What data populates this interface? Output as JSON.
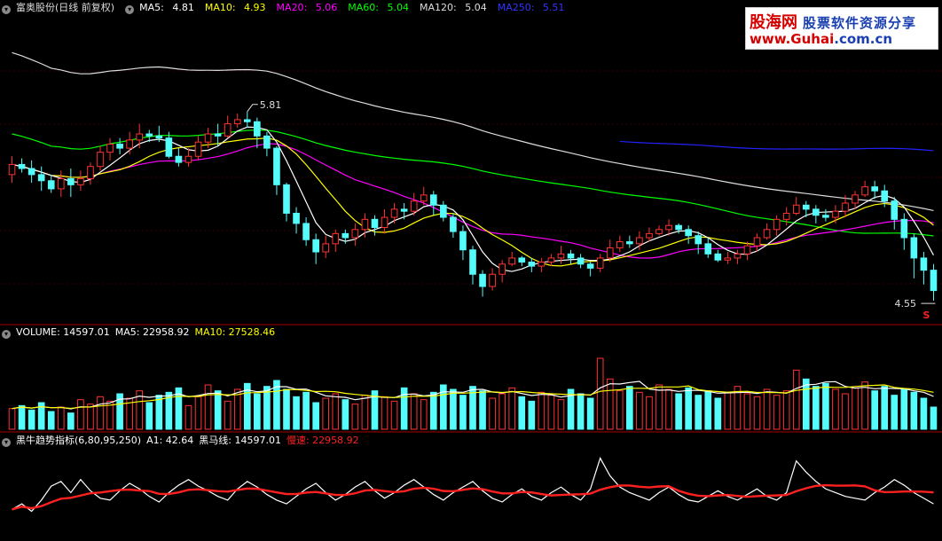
{
  "colors": {
    "ma5": "#ffffff",
    "ma10": "#ffff00",
    "ma20": "#ff00ff",
    "ma60": "#00ff00",
    "ma120": "#dddddd",
    "ma250": "#2222ff",
    "up": "#ff3232",
    "down": "#54fcfc",
    "slow": "#ff2020",
    "divider": "#aa0000"
  },
  "price_panel": {
    "title": "富奥股份(日线 前复权)",
    "ma5": {
      "label": "MA5:",
      "value": "4.81"
    },
    "ma10": {
      "label": "MA10:",
      "value": "4.93"
    },
    "ma20": {
      "label": "MA20:",
      "value": "5.06"
    },
    "ma60": {
      "label": "MA60:",
      "value": "5.04"
    },
    "ma120": {
      "label": "MA120:",
      "value": "5.04"
    },
    "ma250": {
      "label": "MA250:",
      "value": "5.51"
    },
    "high_marker": "5.81",
    "low_marker": "4.55",
    "signal_marker": "S"
  },
  "volume_panel": {
    "title": "VOLUME: 14597.01",
    "ma5": "MA5: 22958.92",
    "ma10": "MA10: 27528.46"
  },
  "indicator_panel": {
    "title": "黑牛趋势指标(6,80,95,250)",
    "a1": "A1: 42.64",
    "black_horse": "黑马线: 14597.01",
    "slow": "慢速: 22958.92"
  },
  "watermark": {
    "line1a": "股海网",
    "line1b": "股票软件资源分享",
    "line2a": "www.Guhai",
    "line2b": ".com.cn"
  },
  "chart_data": {
    "type": "candlestick",
    "candles": [
      [
        5.17,
        5.22,
        5.13,
        5.26
      ],
      [
        5.22,
        5.2,
        5.18,
        5.25
      ],
      [
        5.2,
        5.17,
        5.13,
        5.24
      ],
      [
        5.17,
        5.14,
        5.09,
        5.21
      ],
      [
        5.14,
        5.1,
        5.08,
        5.17
      ],
      [
        5.1,
        5.15,
        5.06,
        5.19
      ],
      [
        5.15,
        5.12,
        5.06,
        5.2
      ],
      [
        5.12,
        5.15,
        5.09,
        5.19
      ],
      [
        5.15,
        5.21,
        5.12,
        5.23
      ],
      [
        5.21,
        5.28,
        5.19,
        5.31
      ],
      [
        5.28,
        5.32,
        5.24,
        5.35
      ],
      [
        5.32,
        5.3,
        5.27,
        5.35
      ],
      [
        5.3,
        5.34,
        5.27,
        5.38
      ],
      [
        5.34,
        5.37,
        5.3,
        5.42
      ],
      [
        5.37,
        5.36,
        5.33,
        5.39
      ],
      [
        5.36,
        5.35,
        5.33,
        5.41
      ],
      [
        5.35,
        5.26,
        5.25,
        5.38
      ],
      [
        5.26,
        5.23,
        5.21,
        5.3
      ],
      [
        5.23,
        5.26,
        5.21,
        5.3
      ],
      [
        5.26,
        5.33,
        5.24,
        5.36
      ],
      [
        5.33,
        5.37,
        5.3,
        5.4
      ],
      [
        5.37,
        5.36,
        5.31,
        5.42
      ],
      [
        5.36,
        5.42,
        5.35,
        5.46
      ],
      [
        5.42,
        5.44,
        5.4,
        5.47
      ],
      [
        5.44,
        5.43,
        5.4,
        5.48
      ],
      [
        5.43,
        5.36,
        5.3,
        5.45
      ],
      [
        5.36,
        5.3,
        5.26,
        5.38
      ],
      [
        5.3,
        5.12,
        5.07,
        5.31
      ],
      [
        5.12,
        4.98,
        4.94,
        5.13
      ],
      [
        4.98,
        4.93,
        4.88,
        5.01
      ],
      [
        4.93,
        4.85,
        4.82,
        4.96
      ],
      [
        4.85,
        4.79,
        4.73,
        4.88
      ],
      [
        4.79,
        4.83,
        4.76,
        4.87
      ],
      [
        4.83,
        4.88,
        4.79,
        4.9
      ],
      [
        4.88,
        4.86,
        4.83,
        4.9
      ],
      [
        4.86,
        4.9,
        4.82,
        4.93
      ],
      [
        4.9,
        4.95,
        4.86,
        4.98
      ],
      [
        4.95,
        4.91,
        4.87,
        4.97
      ],
      [
        4.91,
        4.96,
        4.88,
        5
      ],
      [
        4.96,
        5,
        4.93,
        5.03
      ],
      [
        5,
        4.99,
        4.95,
        5.03
      ],
      [
        4.99,
        5.04,
        4.97,
        5.08
      ],
      [
        5.04,
        5.07,
        5.02,
        5.11
      ],
      [
        5.07,
        5.02,
        4.97,
        5.09
      ],
      [
        5.02,
        4.96,
        4.94,
        5.04
      ],
      [
        4.96,
        4.89,
        4.86,
        4.98
      ],
      [
        4.89,
        4.8,
        4.75,
        4.92
      ],
      [
        4.8,
        4.68,
        4.63,
        4.82
      ],
      [
        4.68,
        4.62,
        4.57,
        4.7
      ],
      [
        4.62,
        4.68,
        4.6,
        4.71
      ],
      [
        4.68,
        4.73,
        4.64,
        4.75
      ],
      [
        4.73,
        4.76,
        4.72,
        4.79
      ],
      [
        4.76,
        4.74,
        4.72,
        4.77
      ],
      [
        4.74,
        4.72,
        4.69,
        4.76
      ],
      [
        4.72,
        4.74,
        4.69,
        4.76
      ],
      [
        4.74,
        4.76,
        4.72,
        4.78
      ],
      [
        4.76,
        4.78,
        4.73,
        4.82
      ],
      [
        4.78,
        4.76,
        4.73,
        4.8
      ],
      [
        4.76,
        4.73,
        4.71,
        4.78
      ],
      [
        4.73,
        4.71,
        4.67,
        4.74
      ],
      [
        4.71,
        4.76,
        4.69,
        4.78
      ],
      [
        4.76,
        4.81,
        4.74,
        4.85
      ],
      [
        4.81,
        4.84,
        4.79,
        4.87
      ],
      [
        4.84,
        4.83,
        4.81,
        4.87
      ],
      [
        4.83,
        4.86,
        4.8,
        4.89
      ],
      [
        4.86,
        4.88,
        4.84,
        4.91
      ],
      [
        4.88,
        4.9,
        4.87,
        4.92
      ],
      [
        4.9,
        4.92,
        4.87,
        4.95
      ],
      [
        4.92,
        4.9,
        4.88,
        4.93
      ],
      [
        4.9,
        4.87,
        4.83,
        4.92
      ],
      [
        4.87,
        4.83,
        4.78,
        4.89
      ],
      [
        4.83,
        4.78,
        4.76,
        4.86
      ],
      [
        4.78,
        4.75,
        4.74,
        4.8
      ],
      [
        4.75,
        4.76,
        4.73,
        4.79
      ],
      [
        4.76,
        4.78,
        4.73,
        4.8
      ],
      [
        4.78,
        4.82,
        4.75,
        4.84
      ],
      [
        4.82,
        4.86,
        4.79,
        4.88
      ],
      [
        4.86,
        4.9,
        4.85,
        4.93
      ],
      [
        4.9,
        4.95,
        4.87,
        4.97
      ],
      [
        4.95,
        4.98,
        4.92,
        5.01
      ],
      [
        4.98,
        5.02,
        4.97,
        5.06
      ],
      [
        5.02,
        5,
        4.96,
        5.04
      ],
      [
        5,
        4.97,
        4.93,
        5.02
      ],
      [
        4.97,
        4.96,
        4.94,
        5
      ],
      [
        4.96,
        4.99,
        4.93,
        5.02
      ],
      [
        4.99,
        5.03,
        4.96,
        5.07
      ],
      [
        5.03,
        5.07,
        5,
        5.09
      ],
      [
        5.07,
        5.11,
        5.06,
        5.14
      ],
      [
        5.11,
        5.09,
        5.05,
        5.14
      ],
      [
        5.09,
        5.04,
        5.01,
        5.12
      ],
      [
        5.04,
        4.95,
        4.9,
        5.06
      ],
      [
        4.95,
        4.86,
        4.8,
        4.98
      ],
      [
        4.86,
        4.76,
        4.66,
        4.88
      ],
      [
        4.76,
        4.7,
        4.63,
        4.79
      ],
      [
        4.7,
        4.6,
        4.55,
        4.73
      ]
    ],
    "volume": [
      14,
      16,
      13,
      18,
      12,
      15,
      11,
      20,
      17,
      22,
      19,
      24,
      21,
      26,
      18,
      23,
      25,
      28,
      16,
      22,
      30,
      26,
      19,
      27,
      31,
      24,
      29,
      33,
      27,
      22,
      25,
      18,
      21,
      24,
      20,
      17,
      23,
      26,
      22,
      19,
      28,
      24,
      20,
      25,
      30,
      27,
      23,
      29,
      26,
      21,
      24,
      28,
      22,
      19,
      25,
      23,
      20,
      27,
      24,
      21,
      48,
      34,
      26,
      29,
      25,
      22,
      30,
      27,
      24,
      28,
      23,
      26,
      21,
      25,
      29,
      24,
      22,
      27,
      23,
      26,
      40,
      34,
      29,
      31,
      27,
      24,
      28,
      32,
      26,
      29,
      23,
      27,
      25,
      21,
      15
    ],
    "indicator": {
      "a1": [
        20,
        22,
        18,
        28,
        35,
        40,
        32,
        45,
        38,
        30,
        28,
        34,
        41,
        36,
        30,
        26,
        33,
        38,
        45,
        40,
        35,
        30,
        28,
        36,
        42,
        38,
        32,
        28,
        24,
        30,
        36,
        40,
        34,
        28,
        32,
        38,
        42,
        36,
        30,
        34,
        40,
        44,
        38,
        32,
        28,
        34,
        38,
        42,
        36,
        30,
        26,
        32,
        36,
        30,
        28,
        34,
        38,
        32,
        28,
        36,
        70,
        52,
        40,
        36,
        32,
        28,
        34,
        38,
        32,
        28,
        26,
        30,
        34,
        30,
        28,
        32,
        36,
        30,
        28,
        34,
        68,
        55,
        46,
        40,
        36,
        32,
        30,
        28,
        34,
        38,
        44,
        40,
        34,
        30,
        26
      ],
      "black_horse": [
        30,
        36,
        28,
        40,
        55,
        60,
        48,
        62,
        50,
        42,
        40,
        50,
        58,
        52,
        44,
        38,
        48,
        56,
        62,
        55,
        50,
        44,
        40,
        52,
        60,
        54,
        46,
        40,
        36,
        44,
        52,
        58,
        48,
        40,
        46,
        54,
        60,
        50,
        42,
        48,
        56,
        62,
        54,
        46,
        40,
        48,
        54,
        60,
        50,
        42,
        38,
        46,
        52,
        44,
        40,
        48,
        54,
        46,
        40,
        52,
        85,
        66,
        54,
        48,
        44,
        40,
        48,
        54,
        46,
        40,
        38,
        44,
        50,
        44,
        40,
        46,
        52,
        44,
        40,
        48,
        82,
        70,
        60,
        52,
        48,
        44,
        42,
        40,
        48,
        54,
        62,
        56,
        48,
        42,
        36
      ]
    }
  }
}
